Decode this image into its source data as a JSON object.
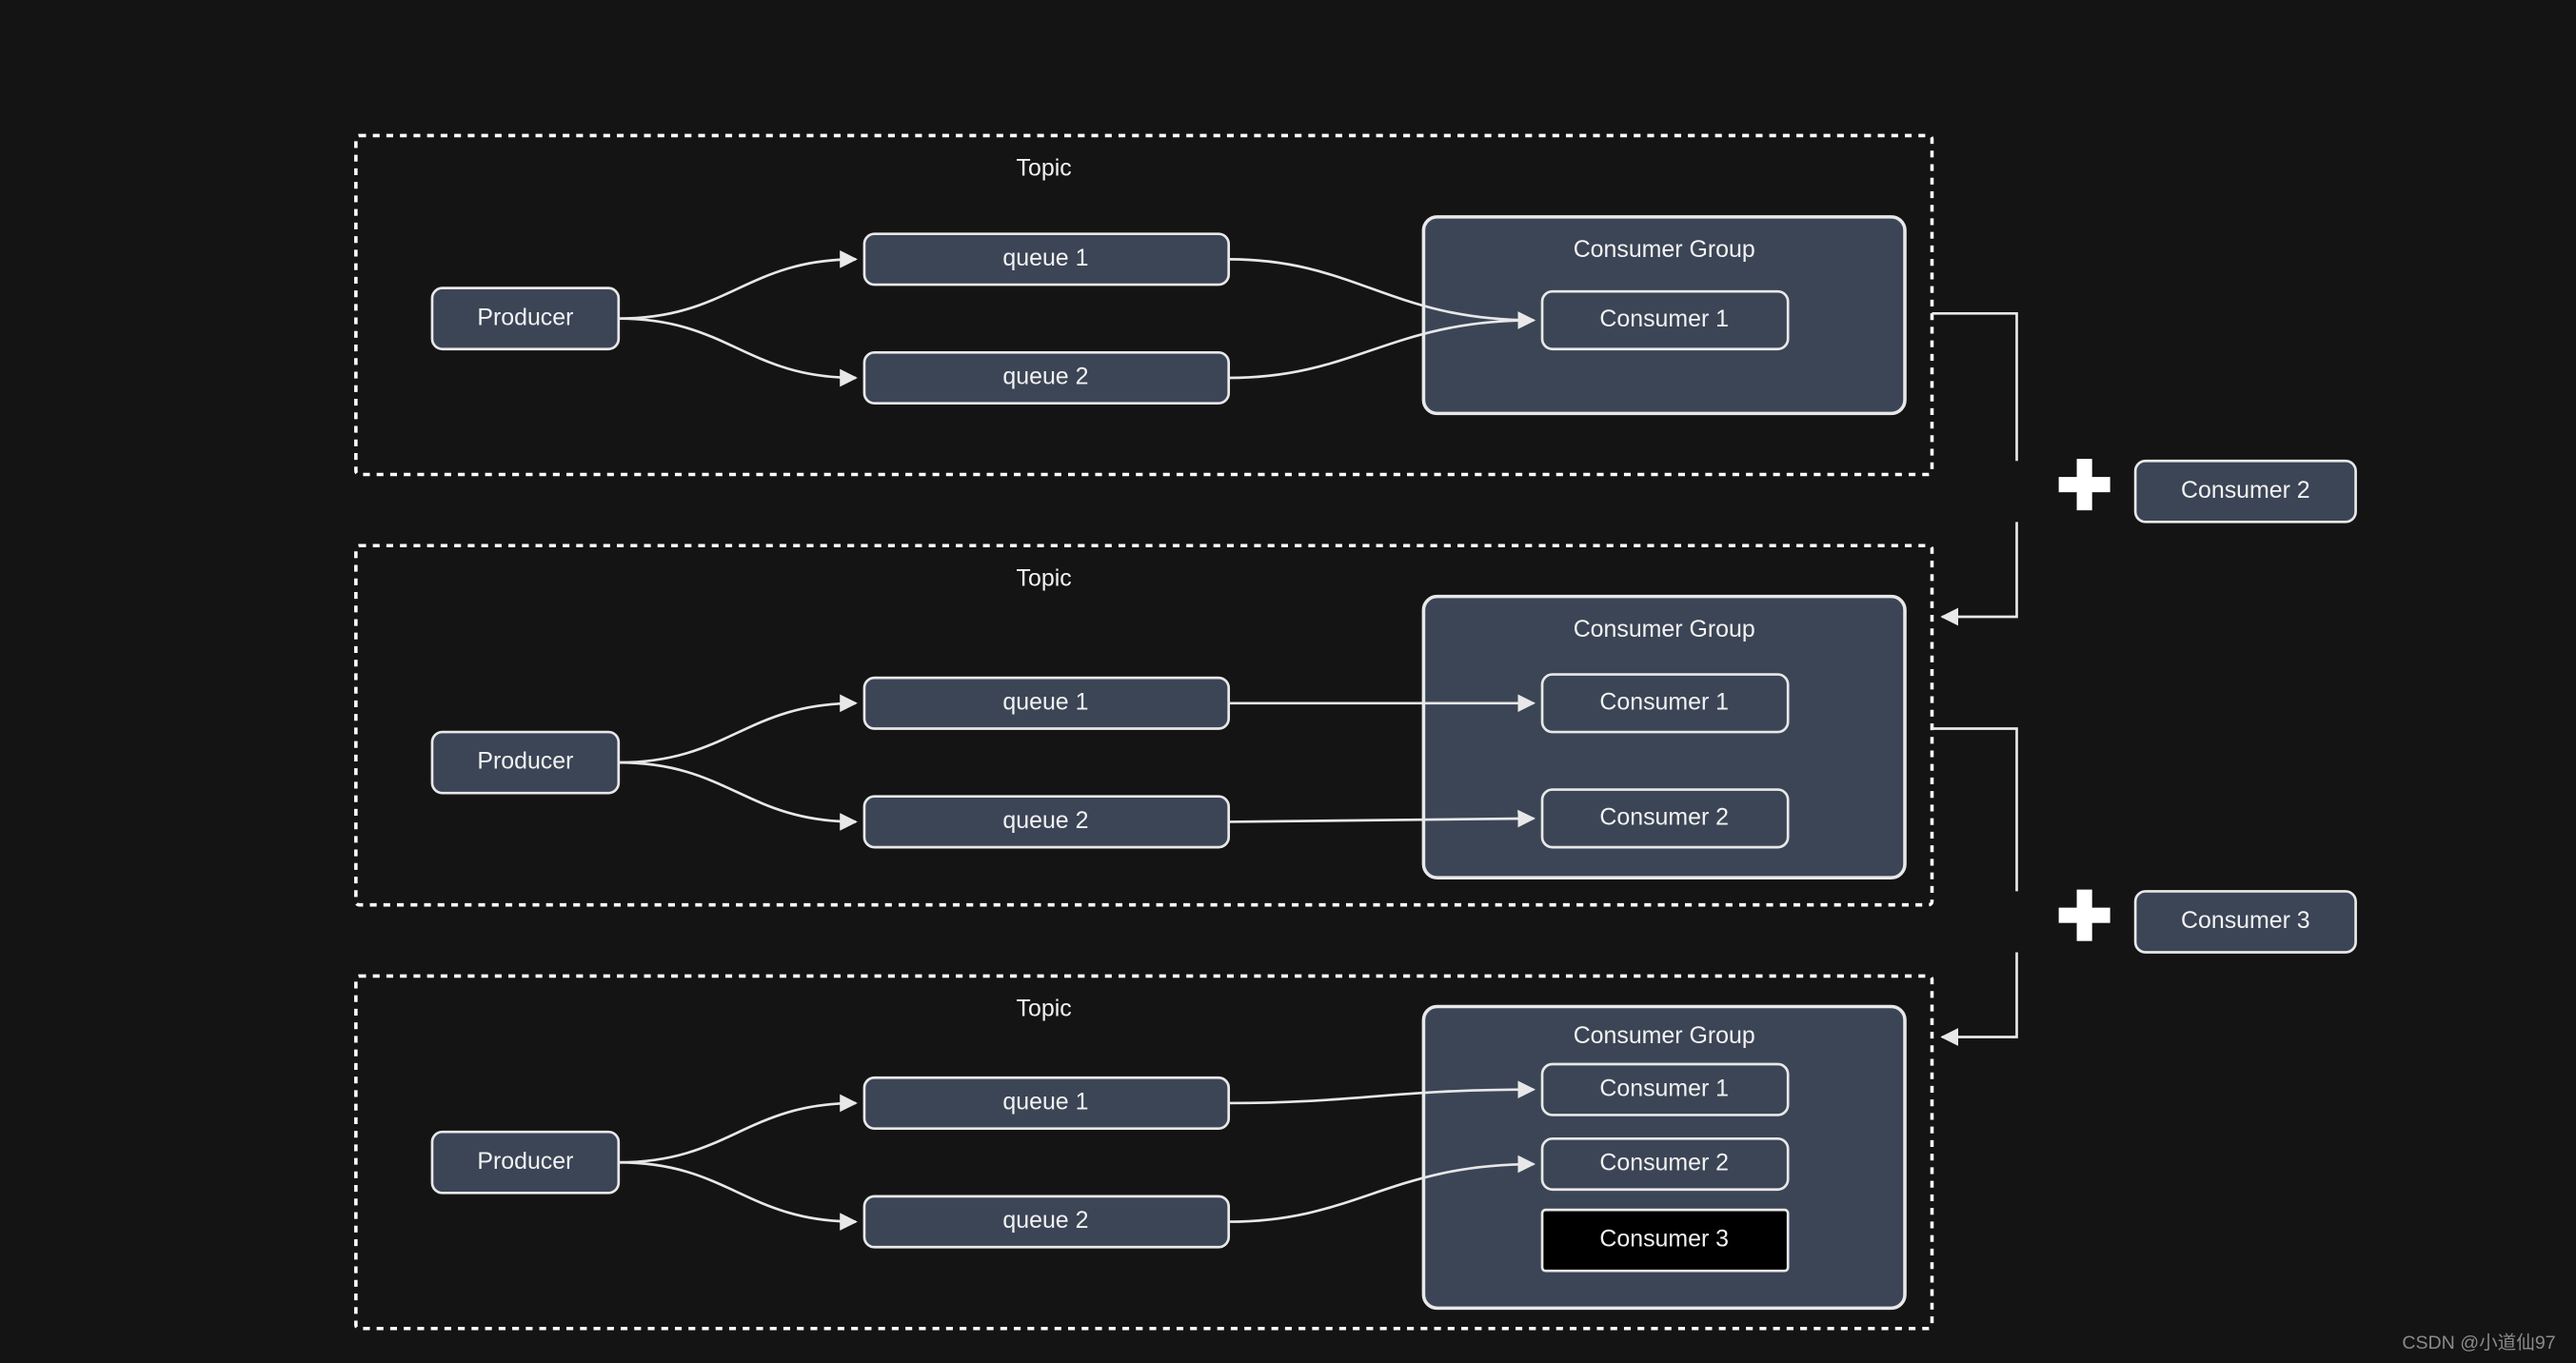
{
  "watermark": "CSDN @小道仙97",
  "add": {
    "plus": "✚",
    "c2": "Consumer 2",
    "c3": "Consumer 3"
  },
  "panels": [
    {
      "title": "Topic",
      "producer": "Producer",
      "queues": [
        "queue 1",
        "queue 2"
      ],
      "group_title": "Consumer Group",
      "consumers": [
        "Consumer 1"
      ]
    },
    {
      "title": "Topic",
      "producer": "Producer",
      "queues": [
        "queue 1",
        "queue 2"
      ],
      "group_title": "Consumer Group",
      "consumers": [
        "Consumer 1",
        "Consumer 2"
      ]
    },
    {
      "title": "Topic",
      "producer": "Producer",
      "queues": [
        "queue 1",
        "queue 2"
      ],
      "group_title": "Consumer Group",
      "consumers": [
        "Consumer 1",
        "Consumer 2",
        "Consumer 3"
      ]
    }
  ]
}
